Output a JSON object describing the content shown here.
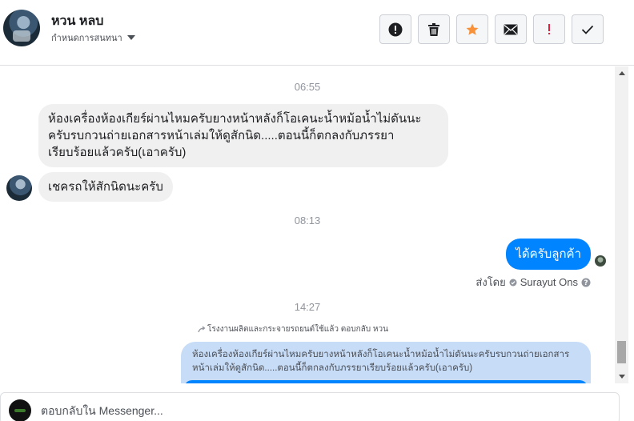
{
  "header": {
    "contact_name": "หวน หลบ",
    "subtitle": "กำหนดการสนทนา",
    "actions": [
      {
        "icon": "alert-circle-icon"
      },
      {
        "icon": "trash-icon"
      },
      {
        "icon": "star-icon",
        "color": "#f7923a"
      },
      {
        "icon": "envelope-icon"
      },
      {
        "icon": "exclamation-icon",
        "color": "#e41e3f"
      },
      {
        "icon": "checkmark-icon"
      }
    ]
  },
  "chat": {
    "time_1": "06:55",
    "msg_in_1": "ห้องเครื่องห้องเกียร์ผ่านไหมครับยางหน้าหลังก็โอเคนะน้ำหม้อน้ำไม่ดันนะครับรบกวนถ่ายเอกสารหน้าเล่มให้ดูสักนิด.....ตอนนี้ก็ตกลงกับภรรยาเรียบร้อยแล้วครับ(เอาครับ)",
    "msg_in_2": "เชครถให้สักนิดนะครับ",
    "time_2": "08:13",
    "msg_out_1": "ได้ครับลูกค้า",
    "sent_by_label": "ส่งโดย",
    "sent_by_name": "Surayut Ons",
    "time_3": "14:27",
    "reply_label": "โรงงานผลิตและกระจายรถยนต์ใช้แล้ว ตอบกลับ หวน",
    "quoted_text": "ห้องเครื่องห้องเกียร์ผ่านไหมครับยางหน้าหลังก็โอเคนะน้ำหม้อน้ำไม่ดันนะครับรบกวนถ่ายเอกสารหน้าเล่มให้ดูสักนิด.....ตอนนี้ก็ตกลงกับภรรยาเรียบร้อยแล้วครับ(เอาครับ)"
  },
  "composer": {
    "placeholder": "ตอบกลับใน Messenger..."
  },
  "colors": {
    "outgoing_bubble": "#0084ff",
    "incoming_bubble": "#f1f0f0",
    "quoted_bubble": "#c7dcf7"
  }
}
